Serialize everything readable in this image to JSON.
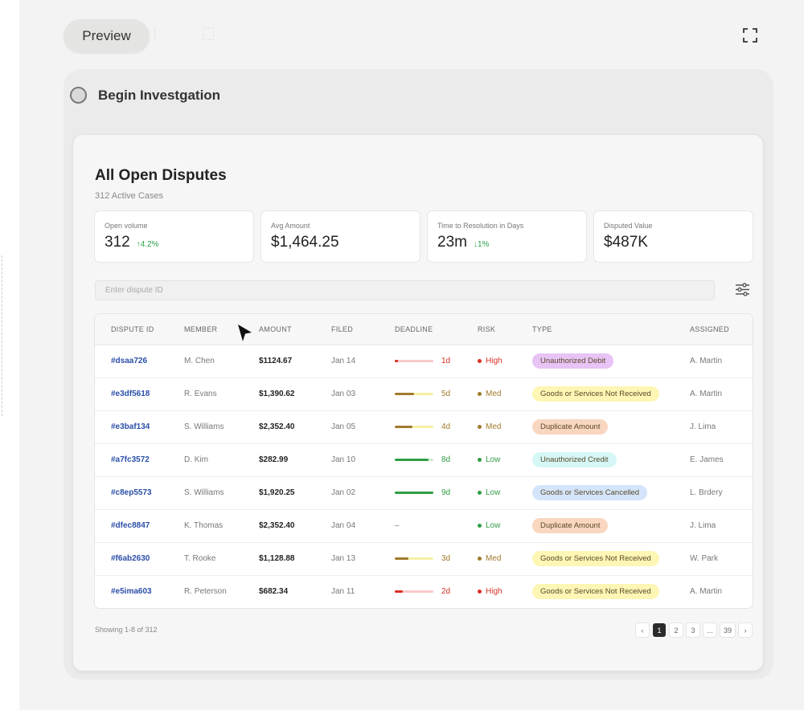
{
  "header": {
    "preview_label": "Preview"
  },
  "step": {
    "label": "Begin Investgation"
  },
  "card": {
    "title": "All Open Disputes",
    "subtitle": "312 Active Cases"
  },
  "stats": [
    {
      "label": "Open volume",
      "value": "312",
      "delta": "↑4.2%"
    },
    {
      "label": "Avg Amount",
      "value": "$1,464.25",
      "delta": ""
    },
    {
      "label": "Time to Resolution in Days",
      "value": "23m",
      "delta": "↓1%"
    },
    {
      "label": "Disputed Value",
      "value": "$487K",
      "delta": ""
    }
  ],
  "search": {
    "placeholder": "Enter dispute ID"
  },
  "table": {
    "headers": [
      "DISPUTE ID",
      "MEMBER",
      "AMOUNT",
      "FILED",
      "DEADLINE",
      "RISK",
      "TYPE",
      "ASSIGNED"
    ],
    "rows": [
      {
        "id": "#dsaa726",
        "member": "M. Chen",
        "amount": "$1124.67",
        "filed": "Jan 14",
        "deadline": "1d",
        "deadline_fraction": 0.08,
        "risk": "High",
        "type": "Unauthorized Debit",
        "type_style": "purple",
        "assigned": "A. Martin"
      },
      {
        "id": "#e3df5618",
        "member": "R. Evans",
        "amount": "$1,390.62",
        "filed": "Jan 03",
        "deadline": "5d",
        "deadline_fraction": 0.5,
        "risk": "Med",
        "type": "Goods or Services Not Received",
        "type_style": "yellow",
        "assigned": "A. Martin"
      },
      {
        "id": "#e3baf134",
        "member": "S. Williams",
        "amount": "$2,352.40",
        "filed": "Jan 05",
        "deadline": "4d",
        "deadline_fraction": 0.45,
        "risk": "Med",
        "type": "Duplicate Amount",
        "type_style": "orange",
        "assigned": "J. Lima"
      },
      {
        "id": "#a7fc3572",
        "member": "D. Kim",
        "amount": "$282.99",
        "filed": "Jan 10",
        "deadline": "8d",
        "deadline_fraction": 0.88,
        "risk": "Low",
        "type": "Unauthorized Credit",
        "type_style": "cyan",
        "assigned": "E. James"
      },
      {
        "id": "#c8ep5573",
        "member": "S. Williams",
        "amount": "$1,920.25",
        "filed": "Jan 02",
        "deadline": "9d",
        "deadline_fraction": 1.0,
        "risk": "Low",
        "type": "Goods or Services Cancelled",
        "type_style": "blue",
        "assigned": "L. Brdery"
      },
      {
        "id": "#dfec8847",
        "member": "K. Thomas",
        "amount": "$2,352.40",
        "filed": "Jan 04",
        "deadline": "–",
        "deadline_fraction": 0,
        "risk": "Low",
        "type": "Duplicate Amount",
        "type_style": "orange",
        "assigned": "J. Lima"
      },
      {
        "id": "#f6ab2630",
        "member": "T. Rooke",
        "amount": "$1,128.88",
        "filed": "Jan 13",
        "deadline": "3d",
        "deadline_fraction": 0.35,
        "risk": "Med",
        "type": "Goods or Services Not Received",
        "type_style": "yellow",
        "assigned": "W. Park"
      },
      {
        "id": "#e5ima603",
        "member": "R. Peterson",
        "amount": "$682.34",
        "filed": "Jan 11",
        "deadline": "2d",
        "deadline_fraction": 0.2,
        "risk": "High",
        "type": "Goods or Services Not Received",
        "type_style": "yellow",
        "assigned": "A. Martin"
      }
    ]
  },
  "footer": {
    "showing": "Showing 1-8 of 312",
    "pages": [
      "‹",
      "1",
      "2",
      "3",
      "...",
      "39",
      "›"
    ],
    "active_page": "1"
  },
  "colors": {
    "risk_high": "#d93025",
    "risk_med": "#a07a2c",
    "risk_low": "#2e9e44",
    "badge_purple": "#e8c3f5",
    "badge_yellow": "#fdf6b4",
    "badge_orange": "#f9d6bf",
    "badge_cyan": "#d5f7f6",
    "badge_blue": "#d4e5fb"
  }
}
